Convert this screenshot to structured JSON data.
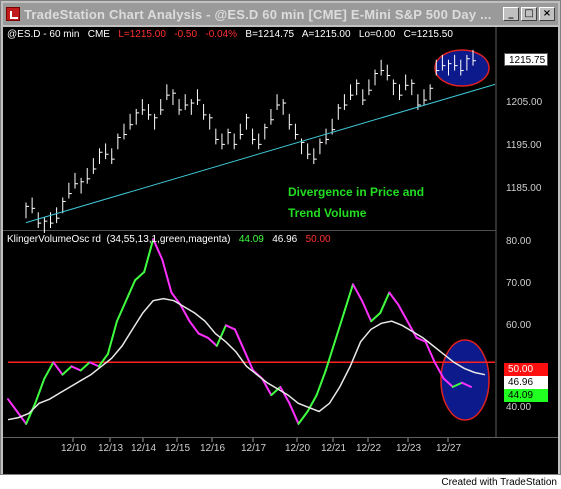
{
  "window": {
    "title": "TradeStation Chart Analysis - @ES.D  60 min  [CME] E-Mini S&P 500 Day ...",
    "buttons": [
      "minimize",
      "maximize",
      "close"
    ]
  },
  "price_header": {
    "symbol": "@ES.D - 60 min",
    "exchange": "CME",
    "last": "L=1215.00",
    "change": "-0.50",
    "change_pct": "-0.04%",
    "bid": "B=1214.75",
    "ask": "A=1215.00",
    "low": "Lo=0.00",
    "close": "C=1215.50"
  },
  "indicator_header": {
    "name": "KlingerVolumeOsc rd",
    "params": "(34,55,13,1,green,magenta)",
    "v1": "44.09",
    "v2": "46.96",
    "v3": "50.00"
  },
  "annotation": {
    "line1": "Divergence in Price and",
    "line2": "Trend Volume"
  },
  "price_axis": {
    "ticks": [
      "1205.00",
      "1195.00",
      "1185.00"
    ],
    "last_label": "1215.75"
  },
  "osc_axis": {
    "ticks": [
      "80.00",
      "70.00",
      "60.00",
      "40.00"
    ],
    "labels": [
      "50.00",
      "46.96",
      "44.09"
    ]
  },
  "x_axis": {
    "ticks": [
      "12/10",
      "12/13",
      "12/14",
      "12/15",
      "12/16",
      "12/17",
      "12/20",
      "12/21",
      "12/22",
      "12/23",
      "12/27"
    ]
  },
  "footer": "Created with TradeStation",
  "colors": {
    "background": "#000000",
    "trendline": "#40c8d8",
    "osc_up": "#40ff40",
    "osc_down": "#ff30ff",
    "signal": "#e8e8e8",
    "level_line": "#ff2020",
    "highlight_fill": "#0c1a8c",
    "highlight_border": "#e02020"
  },
  "chart_data": [
    {
      "type": "bar",
      "title": "",
      "xlabel": "",
      "ylabel": "",
      "ylim": [
        1181,
        1219
      ],
      "series": [
        {
          "values": [
            1185,
            1186,
            1183,
            1182,
            1183,
            1184,
            1186,
            1189,
            1191,
            1190,
            1192,
            1194,
            1196,
            1197,
            1196,
            1199,
            1201,
            1203,
            1204,
            1206,
            1205,
            1203,
            1206,
            1209,
            1208,
            1206,
            1207,
            1206,
            1208,
            1205,
            1203,
            1200,
            1199,
            1200,
            1199,
            1201,
            1203,
            1200,
            1199,
            1201,
            1204,
            1207,
            1206,
            1203,
            1201,
            1198,
            1197,
            1196,
            1198,
            1200,
            1202,
            1205,
            1207,
            1209,
            1210,
            1208,
            1210,
            1212,
            1214,
            1213,
            1210,
            1209,
            1211,
            1210,
            1207,
            1208,
            1209,
            1214,
            1215,
            1214,
            1215,
            1214,
            1215,
            1216
          ]
        }
      ],
      "trendline": [
        [
          0,
          1182.5
        ],
        [
          73,
          1210
        ]
      ]
    },
    {
      "type": "line",
      "title": "",
      "xlabel": "",
      "ylabel": "",
      "ylim": [
        33,
        82
      ],
      "series": [
        {
          "name": "KVO",
          "values": [
            41,
            38,
            35,
            40,
            46,
            50,
            47,
            49,
            48,
            50,
            49,
            52,
            60,
            65,
            70,
            72,
            80,
            75,
            67,
            64,
            60,
            57,
            56,
            54,
            59,
            58,
            53,
            48,
            46,
            42,
            44,
            40,
            35,
            38,
            42,
            48,
            55,
            62,
            69,
            65,
            60,
            62,
            67,
            64,
            60,
            56,
            55,
            50,
            46,
            44,
            45,
            44
          ]
        },
        {
          "name": "Signal",
          "values": [
            36,
            36.5,
            37.5,
            40,
            41,
            42.5,
            44,
            45.5,
            47,
            49,
            51,
            54,
            58,
            62,
            65,
            65.5,
            65,
            63.5,
            62,
            60,
            57,
            55,
            52.5,
            49,
            47,
            45,
            43.5,
            42,
            40,
            39,
            38,
            40,
            44,
            49,
            55,
            58,
            59.5,
            60,
            59,
            57.5,
            56,
            54,
            52,
            50,
            48.5,
            47.5,
            46.96
          ]
        }
      ],
      "reference_line": 50
    }
  ]
}
